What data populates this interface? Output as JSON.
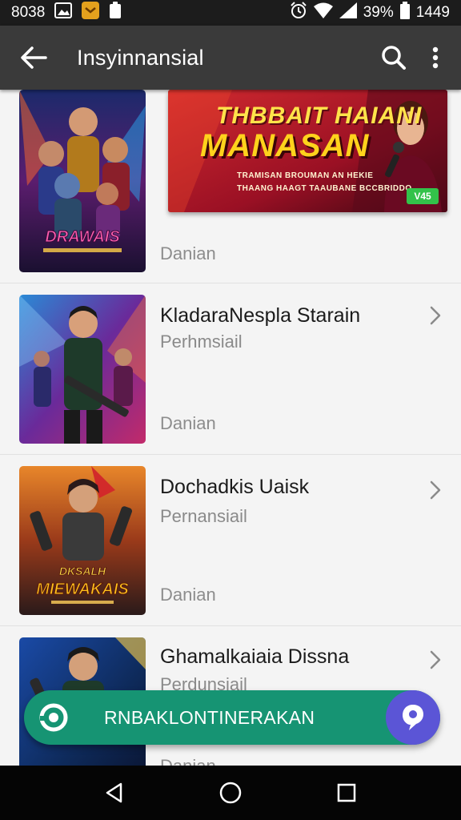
{
  "status_bar": {
    "left_text": "8038",
    "battery": "39%",
    "time": "1449"
  },
  "app_bar": {
    "title": "Insyinnansial"
  },
  "banner": {
    "line1": "THBBAIT HAIANI",
    "line2": "MANASAN",
    "line3": "TRAMISAN BROUMAN AN HEKIE",
    "line4": "THAANG HAAGT TAAUBANE BCCBRIDDO",
    "badge": "V45"
  },
  "items": [
    {
      "title": "",
      "subtitle": "",
      "meta": "Danian",
      "poster_text": "DRAWAIS"
    },
    {
      "title": "KladaraNespla Starain",
      "subtitle": "Perhmsiail",
      "meta": "Danian"
    },
    {
      "title": "Dochadkis Uaisk",
      "subtitle": "Pernansiail",
      "meta": "Danian",
      "poster_text_1": "DKSALH",
      "poster_text_2": "MIEWAKAIS"
    },
    {
      "title": "Ghamalkaiaia Dissna",
      "subtitle": "Perdunsiail",
      "meta": "Danian"
    }
  ],
  "fab": {
    "label": "RNBAKLONTINERAKAN"
  },
  "colors": {
    "app_bar": "#3a3a3a",
    "fab_green": "#169473",
    "fab_purple": "#5b55d6",
    "banner_red": "#b3192a"
  },
  "icons": {
    "back": "arrow-left-icon",
    "search": "search-icon",
    "menu": "more-vert-icon",
    "chevron": "chevron-right-icon",
    "nav_back": "triangle-back-icon",
    "nav_home": "circle-home-icon",
    "nav_recents": "square-recents-icon"
  }
}
